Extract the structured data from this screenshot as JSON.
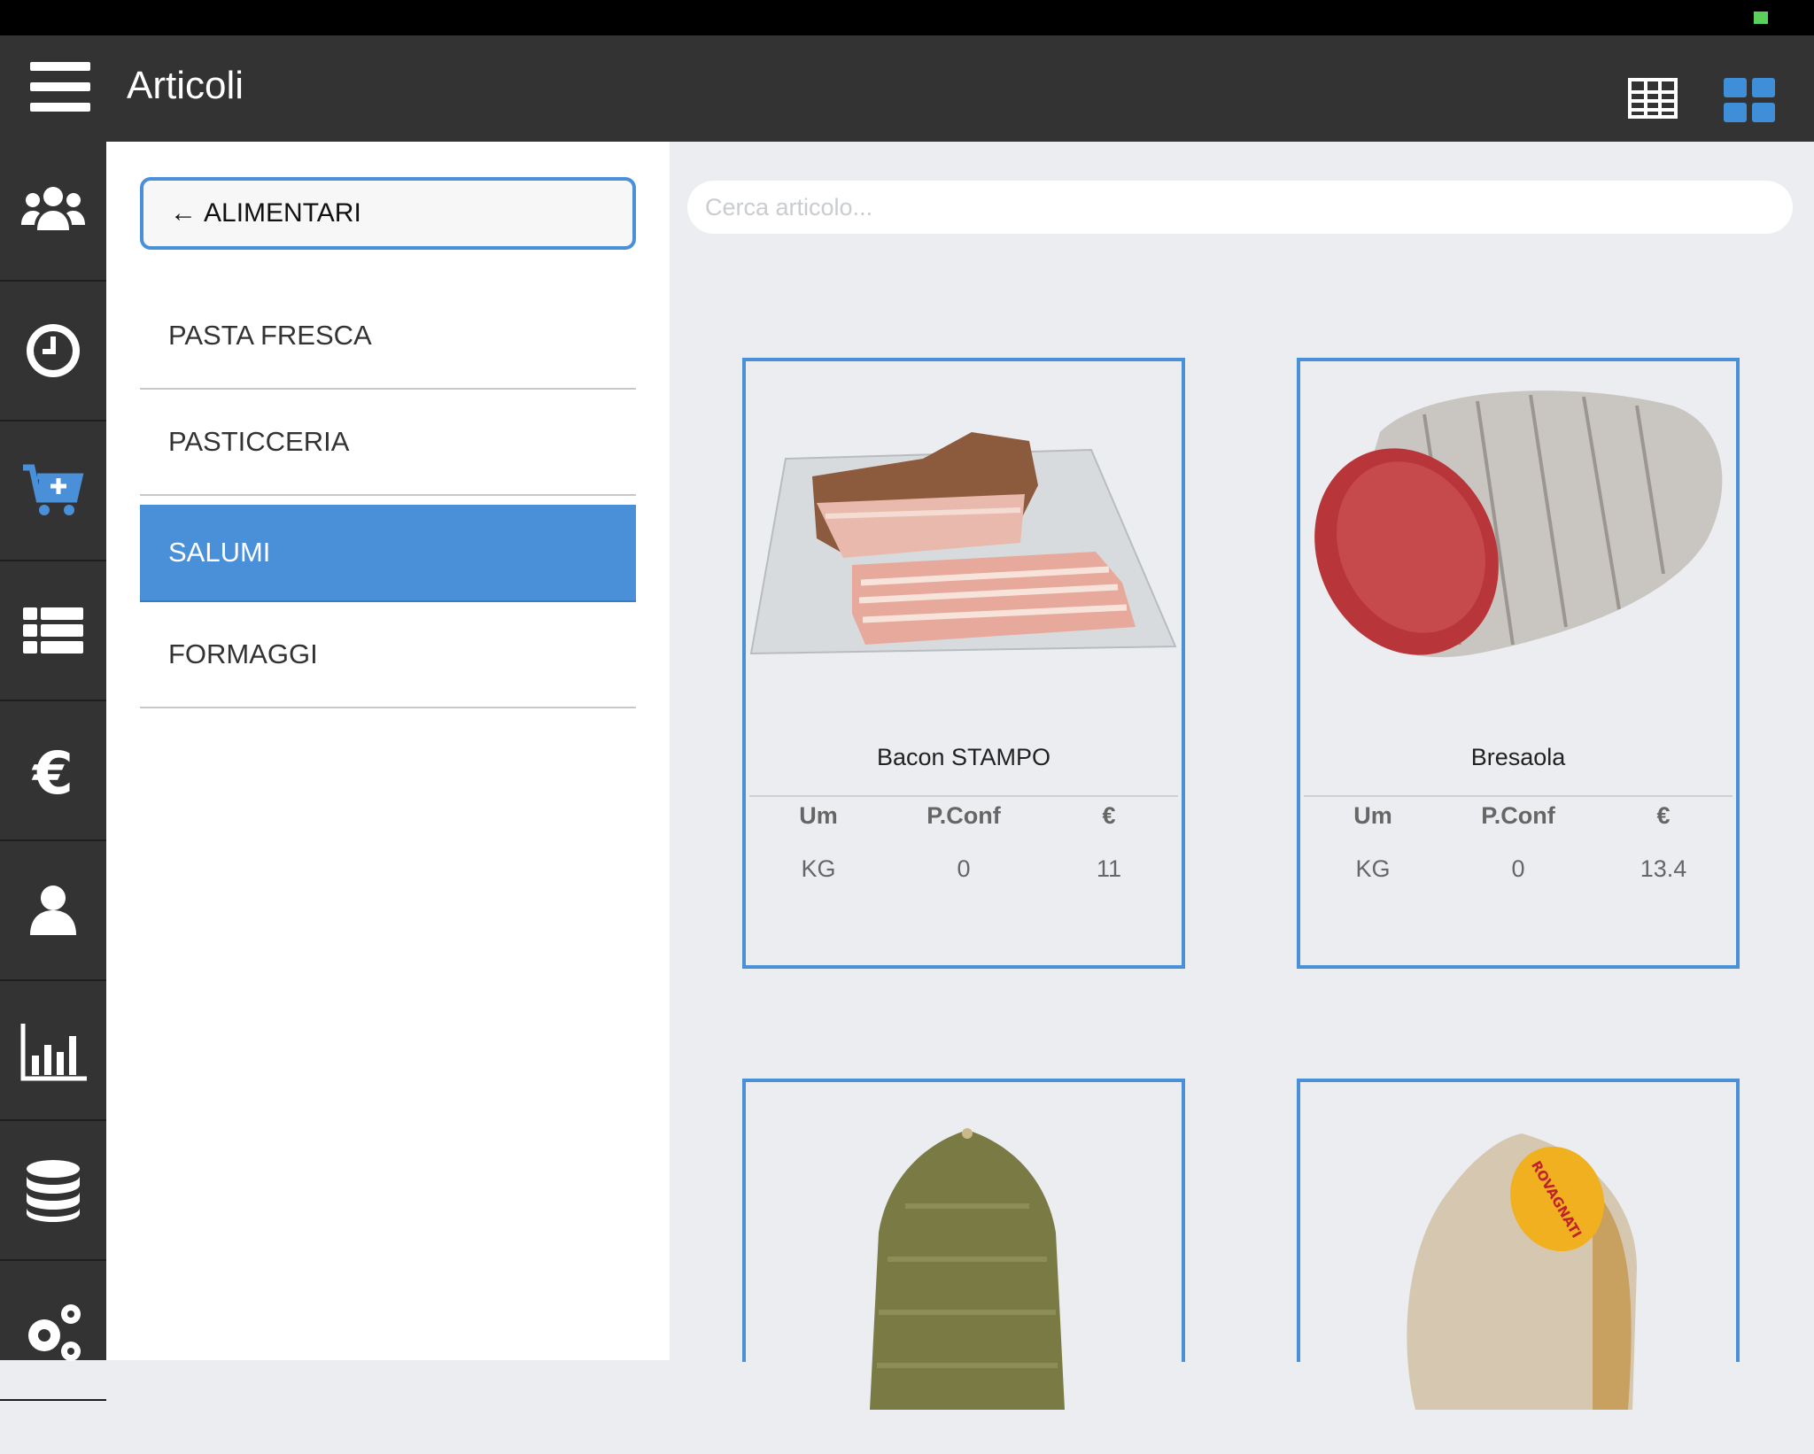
{
  "header": {
    "title": "Articoli"
  },
  "icons": {
    "menu": "hamburger-icon",
    "table_view": "table-view-icon",
    "grid_view": "grid-view-icon",
    "rail": [
      "users-icon",
      "clock-icon",
      "cart-add-icon",
      "list-icon",
      "euro-icon",
      "user-icon",
      "bar-chart-icon",
      "database-icon",
      "settings-icon"
    ]
  },
  "colors": {
    "accent": "#4a90d9",
    "topbar": "#333333",
    "content_bg": "#ebedf0"
  },
  "categories": {
    "back_label": "ALIMENTARI",
    "items": [
      "PASTA FRESCA",
      "PASTICCERIA",
      "SALUMI",
      "FORMAGGI"
    ],
    "selected": "SALUMI"
  },
  "search": {
    "placeholder": "Cerca articolo..."
  },
  "products": [
    {
      "name": "Bacon STAMPO",
      "headers": [
        "Um",
        "P.Conf",
        "€"
      ],
      "um": "KG",
      "pconf": "0",
      "price": "11"
    },
    {
      "name": "Bresaola",
      "headers": [
        "Um",
        "P.Conf",
        "€"
      ],
      "um": "KG",
      "pconf": "0",
      "price": "13.4"
    },
    {
      "name": "",
      "image": "salame-pepe"
    },
    {
      "name": "",
      "image": "prosciutto-rovagnati",
      "brand_label": "ROVAGNATI"
    }
  ]
}
